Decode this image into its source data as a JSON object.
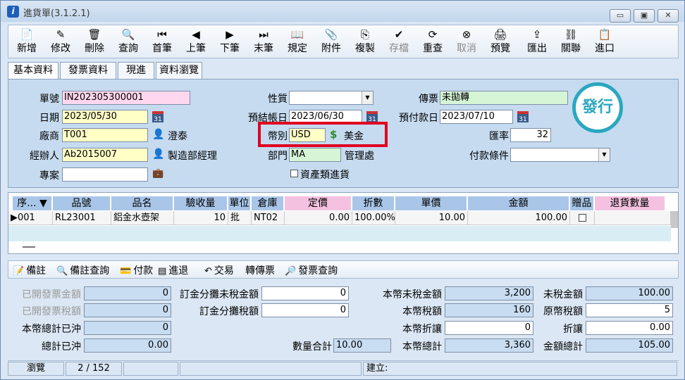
{
  "window": {
    "title": "進貨單(3.1.2.1)",
    "logo": "i",
    "minimize": "▭",
    "restore": "▣",
    "close": "✕"
  },
  "toolbar": [
    {
      "label": "新增",
      "icon": "new-doc-icon",
      "glyph": "📄",
      "enabled": true
    },
    {
      "label": "修改",
      "icon": "edit-icon",
      "glyph": "✎",
      "enabled": true
    },
    {
      "label": "刪除",
      "icon": "trash-icon",
      "glyph": "🗑",
      "enabled": true
    },
    {
      "label": "查詢",
      "icon": "search-icon",
      "glyph": "🔍",
      "enabled": true
    },
    {
      "label": "首筆",
      "icon": "first-record-icon",
      "glyph": "⏮",
      "enabled": true
    },
    {
      "label": "上筆",
      "icon": "prev-record-icon",
      "glyph": "◀",
      "enabled": true
    },
    {
      "label": "下筆",
      "icon": "next-record-icon",
      "glyph": "▶",
      "enabled": true
    },
    {
      "label": "末筆",
      "icon": "last-record-icon",
      "glyph": "⏭",
      "enabled": true
    },
    {
      "label": "規定",
      "icon": "book-icon",
      "glyph": "📖",
      "enabled": true
    },
    {
      "label": "附件",
      "icon": "attachment-icon",
      "glyph": "📎",
      "enabled": true
    },
    {
      "label": "複製",
      "icon": "copy-icon",
      "glyph": "⎘",
      "enabled": true
    },
    {
      "label": "存檔",
      "icon": "save-check-icon",
      "glyph": "✔",
      "enabled": false
    },
    {
      "label": "重查",
      "icon": "refresh-icon",
      "glyph": "⟳",
      "enabled": true
    },
    {
      "label": "取消",
      "icon": "cancel-icon",
      "glyph": "⊗",
      "enabled": false
    },
    {
      "label": "預覽",
      "icon": "print-preview-icon",
      "glyph": "🖨",
      "enabled": true
    },
    {
      "label": "匯出",
      "icon": "export-icon",
      "glyph": "⇪",
      "enabled": true
    },
    {
      "label": "關聯",
      "icon": "relation-icon",
      "glyph": "⛓",
      "enabled": true
    },
    {
      "label": "進口",
      "icon": "import-icon",
      "glyph": "📋",
      "enabled": true
    }
  ],
  "tabs": [
    "基本資料",
    "發票資料",
    "現進",
    "資料瀏覽"
  ],
  "form": {
    "doc_no_label": "單號",
    "doc_no": "IN202305300001",
    "date_label": "日期",
    "date": "2023/05/30",
    "vendor_label": "廠商",
    "vendor": "T001",
    "vendor_name": "澄泰",
    "handler_label": "經辦人",
    "handler": "Ab2015007",
    "handler_name": "製造部經理",
    "project_label": "專案",
    "project": "",
    "nature_label": "性質",
    "nature": "",
    "pre_close_label": "預結帳日",
    "pre_close": "2023/06/30",
    "currency_label": "幣別",
    "currency": "USD",
    "currency_name": "美金",
    "dept_label": "部門",
    "dept": "MA",
    "dept_name": "管理處",
    "asset_label": "資產類進貨",
    "invoice_label": "傳票",
    "invoice": "未拋轉",
    "prepay_label": "預付款日",
    "prepay": "2023/07/10",
    "rate_label": "匯率",
    "rate": "32",
    "payterm_label": "付款條件",
    "payterm": "",
    "stamp": "發行",
    "cal_glyph": "31"
  },
  "grid": {
    "headers": [
      "序...",
      "品號",
      "品名",
      "驗收量",
      "單位",
      "倉庫",
      "定價",
      "折數",
      "單價",
      "金額",
      "贈品",
      "退貨數量"
    ],
    "row": {
      "seq": "001",
      "part": "RL23001",
      "name": "鋁金水壺架",
      "qty": "10",
      "unit": "批",
      "wh": "NT02",
      "list": "0.00",
      "disc": "100.00%",
      "price": "10.00",
      "amount": "100.00",
      "gift": "",
      "ret": ""
    }
  },
  "actions": [
    {
      "label": "備註",
      "icon": "note-icon",
      "glyph": "📝"
    },
    {
      "label": "備註查詢",
      "icon": "search-icon",
      "glyph": "🔍"
    },
    {
      "label": "付款",
      "icon": "payment-icon",
      "glyph": "💳"
    },
    {
      "label": "進退",
      "icon": "return-icon",
      "glyph": "▤"
    },
    {
      "label": "交易",
      "icon": "undo-icon",
      "glyph": "↶"
    },
    {
      "label": "轉傳票",
      "icon": "",
      "glyph": ""
    },
    {
      "label": "發票查詢",
      "icon": "invoice-search-icon",
      "glyph": "🔎"
    }
  ],
  "summary": {
    "opened_inv_amt_label": "已開發票金額",
    "opened_inv_amt": "0",
    "opened_inv_tax_label": "已開發票稅額",
    "opened_inv_tax": "0",
    "local_total_offset_label": "本幣總計已沖",
    "local_total_offset": "0",
    "total_offset_label": "總計已沖",
    "total_offset": "0.00",
    "deposit_untaxed_label": "訂金分攤未稅金額",
    "deposit_untaxed": "0",
    "deposit_tax_label": "訂金分攤稅額",
    "deposit_tax": "0",
    "qty_total_label": "數量合計",
    "qty_total": "10.00",
    "local_untaxed_label": "本幣未稅金額",
    "local_untaxed": "3,200",
    "local_tax_label": "本幣稅額",
    "local_tax": "160",
    "local_discount_label": "本幣折讓",
    "local_discount": "0",
    "local_total_label": "本幣總計",
    "local_total": "3,360",
    "untaxed_label": "未稅金額",
    "untaxed": "100.00",
    "orig_tax_label": "原幣稅額",
    "orig_tax": "5",
    "discount_label": "折讓",
    "discount": "0.00",
    "amount_total_label": "金額總計",
    "amount_total": "105.00"
  },
  "status": {
    "mode": "瀏覽",
    "record": "2 / 152",
    "created_label": "建立:"
  }
}
